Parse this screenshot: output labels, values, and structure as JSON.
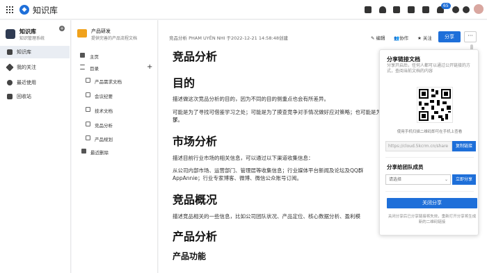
{
  "topbar": {
    "app_title": "知识库",
    "notif_count": "65"
  },
  "sidebar": {
    "workspace_name": "知识库",
    "workspace_sub": "知识管理系统",
    "plus": "+",
    "items": [
      {
        "label": "知识库"
      },
      {
        "label": "我的关注"
      },
      {
        "label": "最近使用"
      },
      {
        "label": "回收站"
      }
    ]
  },
  "tree": {
    "kb_name": "产品研发",
    "kb_sub": "提供完善的产品流程文档",
    "home": "主页",
    "catalog": "目录",
    "add": "+",
    "docs": [
      {
        "label": "产品需求文档"
      },
      {
        "label": "会议纪要"
      },
      {
        "label": "技术文档"
      },
      {
        "label": "竞品分析"
      },
      {
        "label": "产品规划"
      }
    ],
    "recent_deleted": "最近删除"
  },
  "doc_header": {
    "meta": "竞品分析   PHAM UYÊN NHI   于2022-12-21 14:58:48创建",
    "edit": "编辑",
    "collab": "协作",
    "follow": "关注",
    "share": "分享",
    "more": "···"
  },
  "doc": {
    "title": "竞品分析",
    "h_goal": "目的",
    "p_goal1": "描述做这次竞品分析的目的，因为不同的目的侧重点也会有所差异。",
    "p_goal2": "可能是为了寻找可借鉴学习之处；可能是为了摸查竞争对手情况做好应对策略；也可能是为了",
    "p_goal2b": "探。",
    "h_market": "市场分析",
    "p_market1": "描述目前行业市场的相关信息，可以通过以下渠道收集信息：",
    "p_market2": "从公司内部市场、运营部门、管理层等收集信息；行业媒体平台新闻及论坛及QQ群",
    "p_market2b": "AppAnnie；行业专家博客、微博、微信公众账号订阅。",
    "h_overview": "竞品概况",
    "p_overview": "描述竞品相关的一些信息，比如公司团队状况、产品定位、核心数据分析、盈利模",
    "h_product": "产品分析",
    "h_feature": "产品功能"
  },
  "share_popup": {
    "title": "分享链接文档",
    "desc": "分享开启后，任何人都可以通过公开链接的方式，查阅当前文档的内容",
    "qr_hint": "使用手机扫描二维码即可在手机上查看",
    "link": "https://cloud.5kcrm.cn/share",
    "copy_btn": "复制链接",
    "team_title": "分享给团队成员",
    "select_placeholder": "请选择",
    "team_btn": "立即分享",
    "close_btn": "关闭分享",
    "close_note": "关闭分享后已分享链接将失效，重新打开分享将生成新的二维码链接"
  }
}
